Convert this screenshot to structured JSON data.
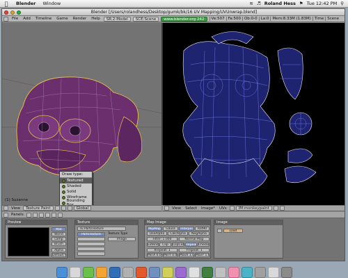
{
  "menubar": {
    "app_name": "Blender",
    "items": [
      "Window"
    ],
    "user": "Roland Hess",
    "clock": "Tue 12:42 PM"
  },
  "window": {
    "title": "Blender [/Users/rolandhess/Desktop/gumk/bk/16 UV Mapping/UVUnwrap.blend]"
  },
  "info_header": {
    "menus": [
      "File",
      "Add",
      "Timeline",
      "Game",
      "Render",
      "Help"
    ],
    "screen": "SR:2-Model",
    "scene": "SCE:Scene",
    "url": "www.blender.org 242",
    "stats": [
      "Ve:507",
      "Fa:500",
      "Ob:0-0",
      "La:0",
      "Mem:8.33M (1.83M)",
      "Time",
      "Scene"
    ]
  },
  "view3d": {
    "label": "(1) Suzanne",
    "draw_menu": {
      "title": "Draw type:",
      "options": [
        "Textured",
        "Shaded",
        "Solid",
        "Wireframe",
        "Bounding Box"
      ],
      "selected": "Textured",
      "icon_color": "#5b7d2c"
    }
  },
  "view3d_header": {
    "menus": [
      "View"
    ],
    "mode": "Texture Paint",
    "orientation": "Global"
  },
  "uv_header": {
    "menus": [
      "View",
      "Select",
      "Image*",
      "UVs"
    ],
    "image": "IM:monkeypaint"
  },
  "buttons_header": {
    "label": "Panels"
  },
  "panels": {
    "preview": {
      "title": "Preview",
      "buttons": [
        "Mat",
        "World",
        "Lamp",
        "Brush",
        "Alpha",
        "Default Vars"
      ]
    },
    "texture": {
      "title": "Texture",
      "field": "TE:PartsTexture",
      "list_item": "PartsTexture",
      "type_label": "Texture Type",
      "type_value": "Image"
    },
    "map_image": {
      "title": "Map Image",
      "row1": [
        "MipMap",
        "Gauss",
        "Interpol",
        "Rot90"
      ],
      "row2": [
        "UseAlpha",
        "CalcAlpha",
        "NegAlpha"
      ],
      "filter": "Filter: 1.000",
      "normal_map": "Normal Map",
      "row4": [
        "Extend",
        "Clip",
        "ClipCube",
        "Repeat",
        "Checker"
      ],
      "xrepeat": "Xrepeat: 1",
      "yrepeat": "Yrepeat: 1",
      "minx": "MinX 0.000",
      "maxx": "MaxX 1.000",
      "miny": "MinY 0.000",
      "maxy": "MaxY 1.000"
    },
    "image": {
      "title": "Image",
      "load_button": "Load"
    }
  },
  "colors": {
    "mesh_fill": "#6b2f6d",
    "mesh_edge": "#e8c24a",
    "uv_wire": "#7c86ff",
    "uv_edge": "#f0f0ff",
    "url_green": "#39a045"
  },
  "dock": {
    "icon_colors": [
      "#4a90d9",
      "#d8d8d8",
      "#6cc04a",
      "#f4a531",
      "#2f6fb7",
      "#b0b0b0",
      "#e25a2a",
      "#6f8fbf",
      "#cfcf5a",
      "#9a6ad0",
      "#e0e0e0",
      "#3f7f3f",
      "#c0c0c0",
      "#f08fb0",
      "#4bb3c8",
      "#a0a0a0",
      "#d9d9d9",
      "#8a8a8a"
    ]
  }
}
